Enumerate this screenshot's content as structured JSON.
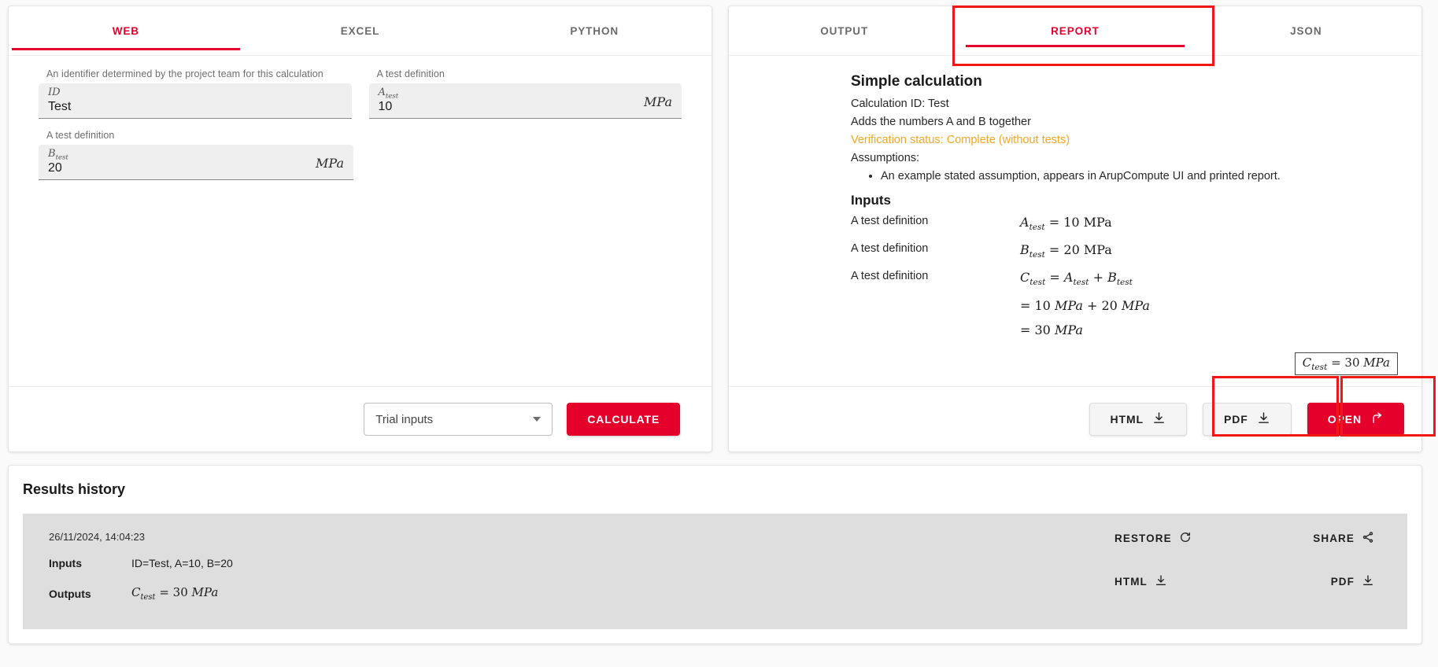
{
  "left_panel": {
    "tabs": [
      {
        "label": "WEB",
        "active": true
      },
      {
        "label": "EXCEL",
        "active": false
      },
      {
        "label": "PYTHON",
        "active": false
      }
    ],
    "fields": [
      {
        "description": "An identifier determined by the project team for this calculation",
        "symbol": "ID",
        "symbol_sub": "",
        "value": "Test",
        "unit": ""
      },
      {
        "description": "A test definition",
        "symbol": "A",
        "symbol_sub": "test",
        "value": "10",
        "unit": "MPa"
      },
      {
        "description": "A test definition",
        "symbol": "B",
        "symbol_sub": "test",
        "value": "20",
        "unit": "MPa"
      }
    ],
    "footer": {
      "select_value": "Trial inputs",
      "calculate_label": "CALCULATE"
    }
  },
  "right_panel": {
    "tabs": [
      {
        "label": "OUTPUT",
        "active": false
      },
      {
        "label": "REPORT",
        "active": true
      },
      {
        "label": "JSON",
        "active": false
      }
    ],
    "report": {
      "title": "Simple calculation",
      "calculation_id": "Calculation ID: Test",
      "summary": "Adds the numbers A and B together",
      "verification_status": "Verification status: Complete (without tests)",
      "assumptions_label": "Assumptions:",
      "assumptions": [
        "An example stated assumption, appears in ArupCompute UI and printed report."
      ],
      "inputs_heading": "Inputs",
      "rows": [
        {
          "description": "A test definition",
          "sym": "A",
          "sub": "test",
          "rhs": "= 10 MPa",
          "continuations": []
        },
        {
          "description": "A test definition",
          "sym": "B",
          "sub": "test",
          "rhs": "= 20 MPa",
          "continuations": []
        },
        {
          "description": "A test definition",
          "sym": "C",
          "sub": "test",
          "rhs": "= A_test + B_test",
          "continuations": [
            "= 10 MPa + 20 MPa",
            "= 30 MPa"
          ]
        }
      ],
      "result_box": "C_test = 30 MPa"
    },
    "footer": {
      "html_label": "HTML",
      "pdf_label": "PDF",
      "open_label": "OPEN"
    }
  },
  "history": {
    "title": "Results history",
    "entry": {
      "timestamp": "26/11/2024, 14:04:23",
      "inputs_label": "Inputs",
      "inputs_value": "ID=Test, A=10, B=20",
      "outputs_label": "Outputs",
      "outputs_value": "C_test = 30 MPa"
    },
    "actions": {
      "restore_label": "RESTORE",
      "share_label": "SHARE",
      "html_label": "HTML",
      "pdf_label": "PDF"
    }
  },
  "colors": {
    "accent": "#e4002b",
    "warning": "#f5a623",
    "annotation": "#f31616"
  }
}
